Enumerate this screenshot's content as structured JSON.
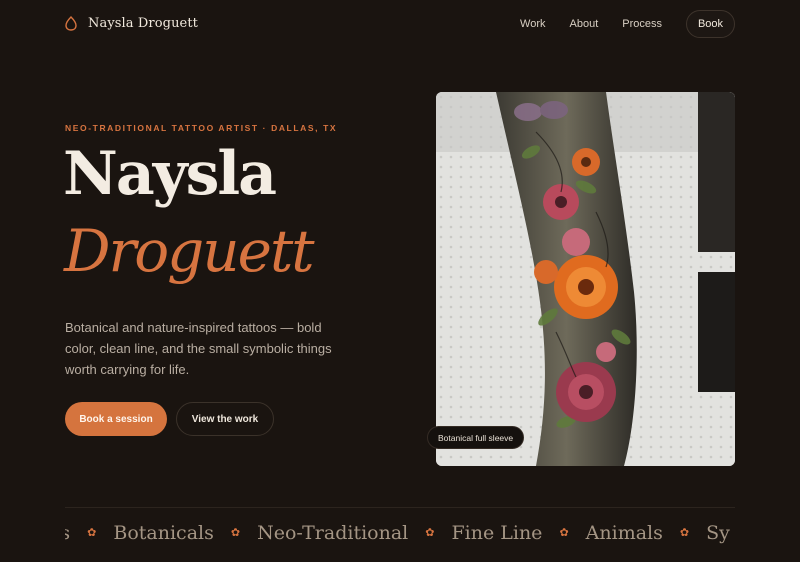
{
  "header": {
    "brand_name": "Naysla Droguett",
    "logo_icon": "flame-outline-icon",
    "nav": [
      {
        "label": "Work"
      },
      {
        "label": "About"
      },
      {
        "label": "Process"
      }
    ],
    "book_label": "Book"
  },
  "hero": {
    "kicker": "NEO-TRADITIONAL TATTOO ARTIST · DALLAS, TX",
    "first_name": "Naysla",
    "last_name": "Droguett",
    "description": "Botanical and nature-inspired tattoos — bold color, clean line, and the small symbolic things worth carrying for life.",
    "primary_cta": "Book a session",
    "secondary_cta": "View the work"
  },
  "photo": {
    "caption": "Botanical full sleeve"
  },
  "marquee": {
    "items": [
      "als",
      "Botanicals",
      "Neo-Traditional",
      "Fine Line",
      "Animals",
      "Sy"
    ],
    "separator_icon": "asterisk-star-icon"
  },
  "colors": {
    "background": "#1a1410",
    "accent": "#d5743e",
    "text": "#efe7dc",
    "muted": "#b9aea2"
  }
}
